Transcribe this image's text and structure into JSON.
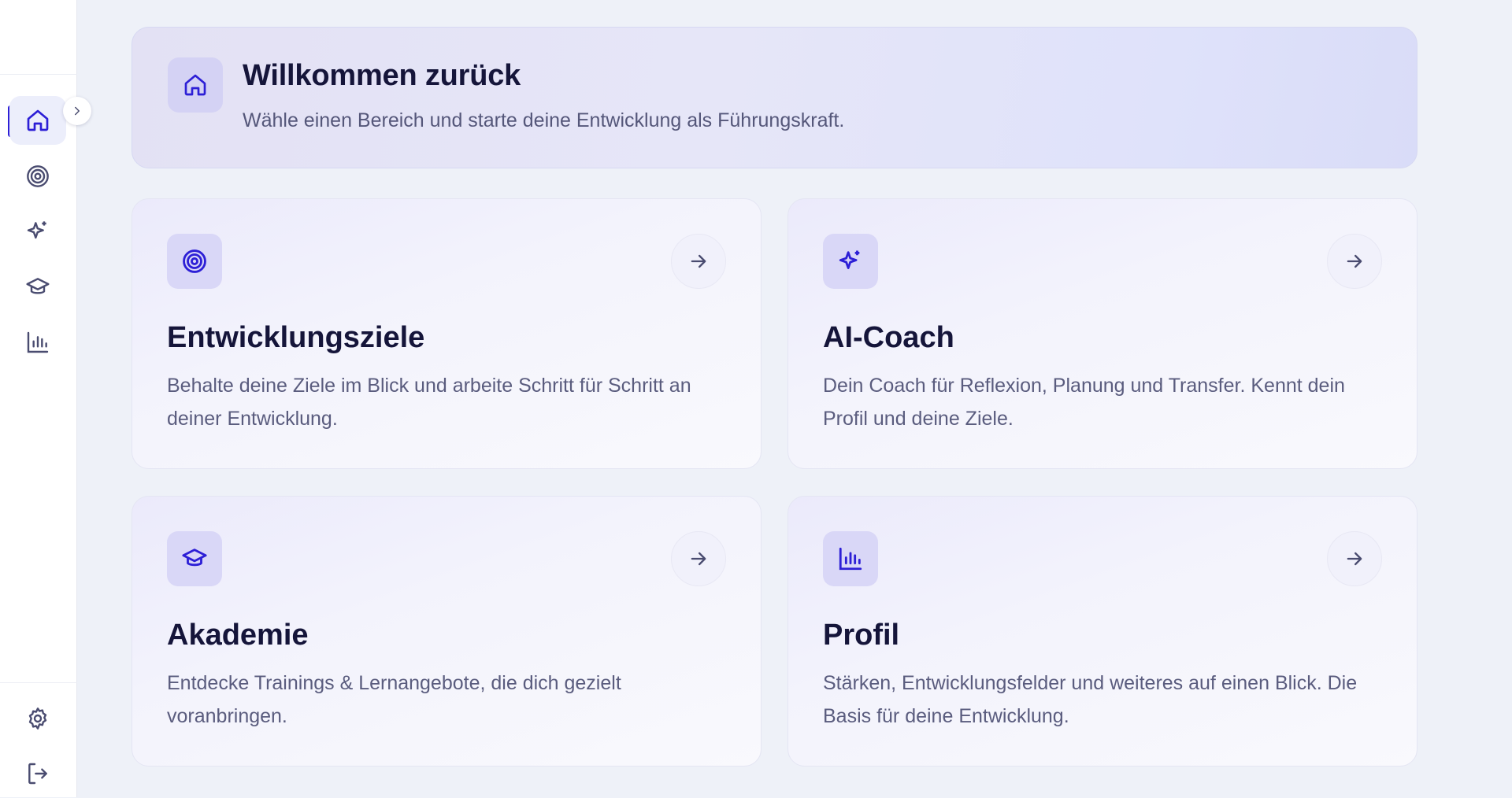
{
  "sidebar": {
    "nav": [
      {
        "name": "home-icon",
        "active": true
      },
      {
        "name": "target-icon",
        "active": false
      },
      {
        "name": "sparkles-icon",
        "active": false
      },
      {
        "name": "graduation-cap-icon",
        "active": false
      },
      {
        "name": "bar-chart-icon",
        "active": false
      }
    ],
    "bottom": [
      {
        "name": "settings-icon"
      },
      {
        "name": "logout-icon"
      }
    ],
    "collapse_icon": "chevron-right-icon"
  },
  "welcome": {
    "title": "Willkommen zurück",
    "subtitle": "Wähle einen Bereich und starte deine Entwicklung als Führungskraft.",
    "icon": "home-icon"
  },
  "cards": [
    {
      "title": "Entwicklungsziele",
      "description": "Behalte deine Ziele im Blick und arbeite Schritt für Schritt an deiner Entwicklung.",
      "icon": "target-icon"
    },
    {
      "title": "AI-Coach",
      "description": "Dein Coach für Reflexion, Planung und Transfer. Kennt dein Profil und deine Ziele.",
      "icon": "sparkles-icon"
    },
    {
      "title": "Akademie",
      "description": "Entdecke Trainings & Lernangebote, die dich gezielt voranbringen.",
      "icon": "graduation-cap-icon"
    },
    {
      "title": "Profil",
      "description": "Stärken, Entwicklungsfelder und weiteres auf einen Blick. Die Basis für deine Entwicklung.",
      "icon": "bar-chart-icon"
    }
  ],
  "colors": {
    "accent": "#2d1fd6",
    "icon_muted": "#4a4c70",
    "title": "#15153a",
    "text": "#5a5c7e"
  }
}
